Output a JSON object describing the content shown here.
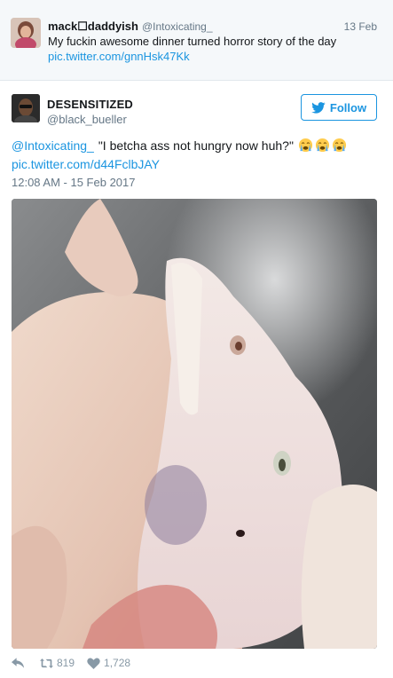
{
  "parent_tweet": {
    "name": "mack☐daddyish",
    "handle": "@Intoxicating_",
    "date": "13 Feb",
    "text": "My fuckin awesome dinner turned horror story of the day",
    "link": "pic.twitter.com/gnnHsk47Kk"
  },
  "tweet": {
    "name": "DESENSITIZED",
    "handle": "@black_bueller",
    "follow_label": "Follow",
    "mention": "@Intoxicating_",
    "quote": "\"I betcha ass not hungry now huh?\"",
    "emoji": [
      "loudly-crying-face",
      "loudly-crying-face",
      "loudly-crying-face"
    ],
    "link": "pic.twitter.com/d44FclbJAY",
    "timestamp": "12:08 AM - 15 Feb 2017",
    "retweets": "819",
    "likes": "1,728"
  },
  "colors": {
    "link": "#1b95e0",
    "muted": "#657786",
    "icon": "#8899a6",
    "emoji": "#ffcc4d"
  }
}
